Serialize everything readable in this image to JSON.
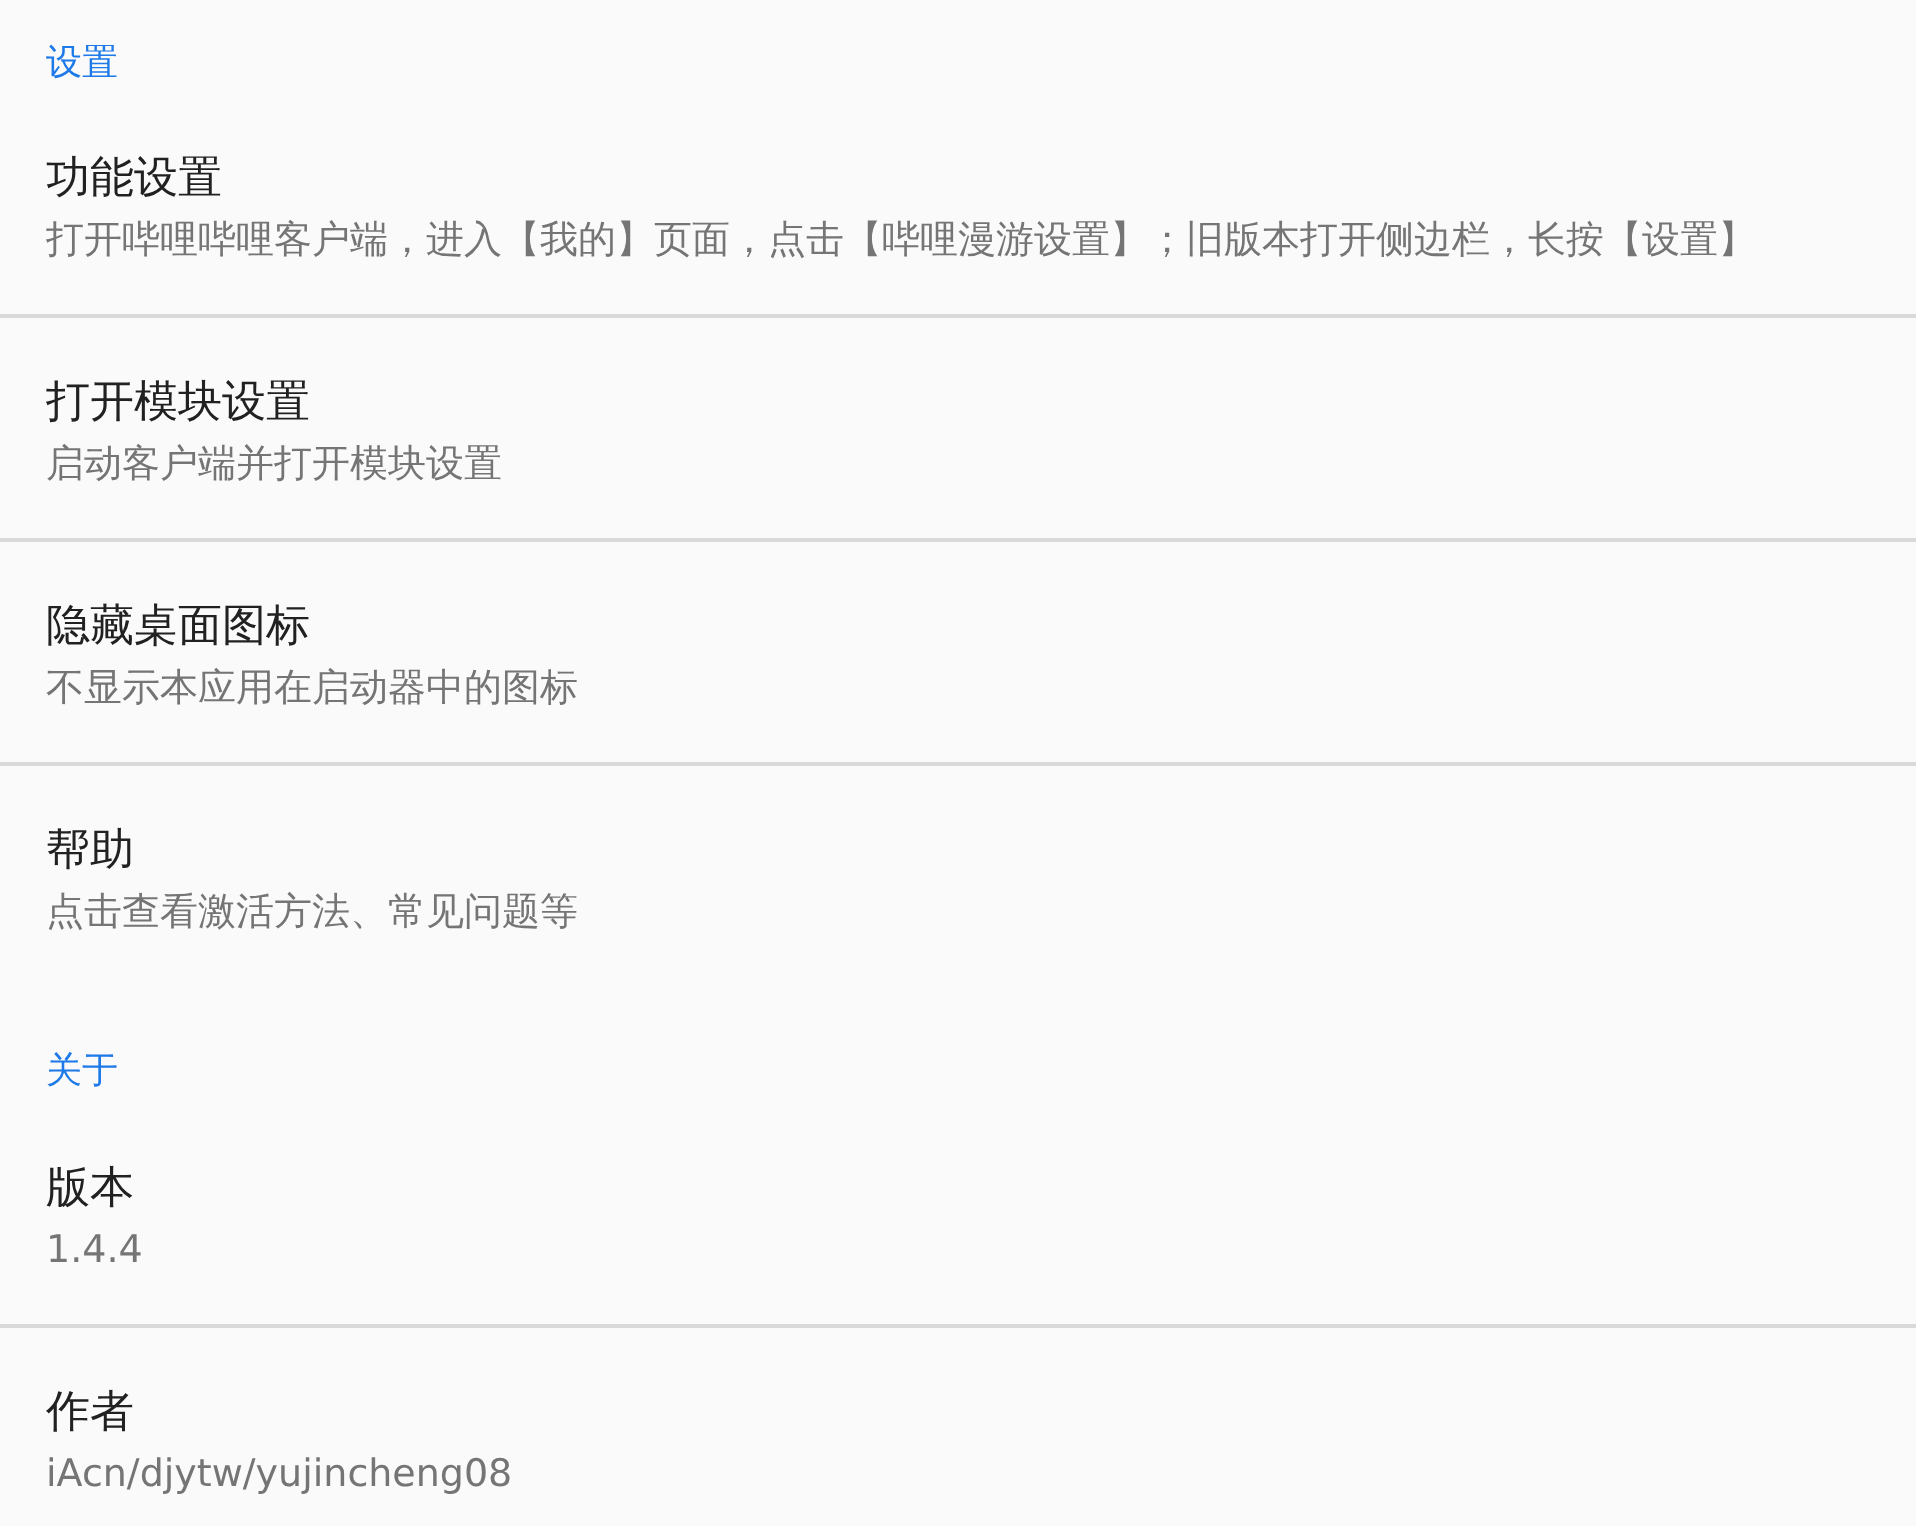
{
  "sections": [
    {
      "title": "设置",
      "items": [
        {
          "title": "功能设置",
          "summary": "打开哔哩哔哩客户端，进入【我的】页面，点击【哔哩漫游设置】；旧版本打开侧边栏，长按【设置】"
        },
        {
          "title": "打开模块设置",
          "summary": "启动客户端并打开模块设置"
        },
        {
          "title": "隐藏桌面图标",
          "summary": "不显示本应用在启动器中的图标"
        },
        {
          "title": "帮助",
          "summary": "点击查看激活方法、常见问题等"
        }
      ]
    },
    {
      "title": "关于",
      "items": [
        {
          "title": "版本",
          "summary": "1.4.4"
        },
        {
          "title": "作者",
          "summary": "iAcn/djytw/yujincheng08"
        }
      ]
    }
  ]
}
